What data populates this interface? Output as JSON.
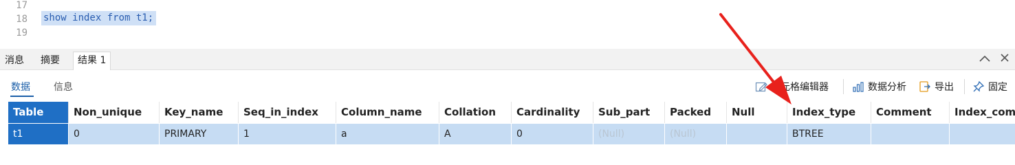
{
  "editor": {
    "line_numbers": [
      "17",
      "18",
      "19"
    ],
    "code": "show index from t1;"
  },
  "result_tabs": [
    "消息",
    "摘要",
    "结果 1"
  ],
  "subtabs": [
    "数据",
    "信息"
  ],
  "toolbar": {
    "cell_editor": "单元格编辑器",
    "data_analysis": "数据分析",
    "export": "导出",
    "pin": "固定"
  },
  "table": {
    "columns": [
      "Table",
      "Non_unique",
      "Key_name",
      "Seq_in_index",
      "Column_name",
      "Collation",
      "Cardinality",
      "Sub_part",
      "Packed",
      "Null",
      "Index_type",
      "Comment",
      "Index_com"
    ],
    "rows": [
      [
        "t1",
        "0",
        "PRIMARY",
        "1",
        "a",
        "A",
        "0",
        "(Null)",
        "(Null)",
        "",
        "BTREE",
        "",
        ""
      ]
    ]
  },
  "colors": {
    "selection_text": "#2a5db0",
    "accent": "#1f6fc5",
    "row_highlight": "#c6dcf3",
    "annotation_arrow": "#e8211c"
  }
}
